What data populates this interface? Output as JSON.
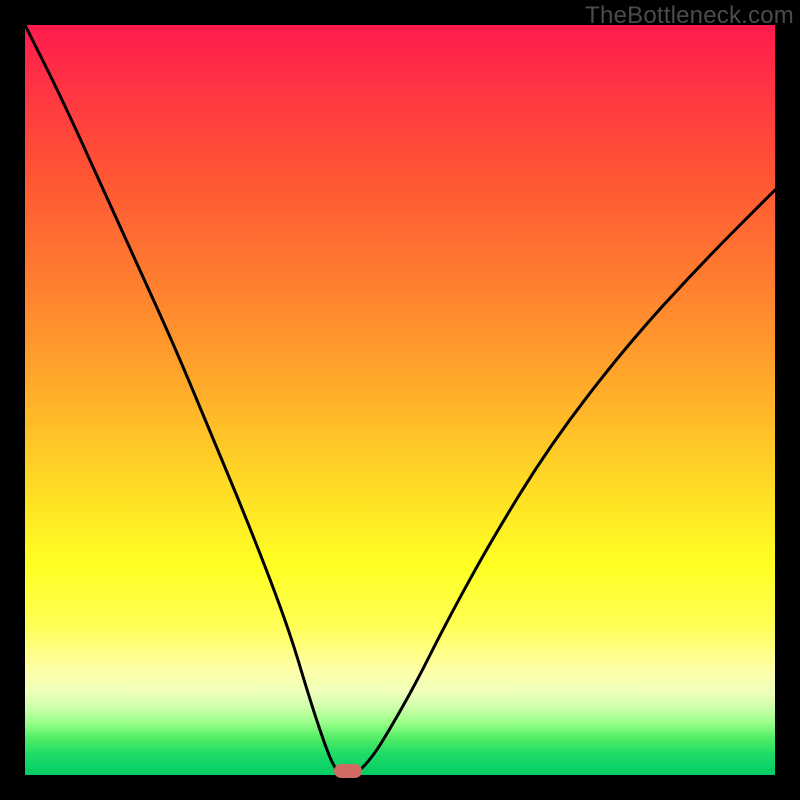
{
  "watermark": "TheBottleneck.com",
  "chart_data": {
    "type": "line",
    "title": "",
    "xlabel": "",
    "ylabel": "",
    "xlim": [
      0,
      100
    ],
    "ylim": [
      0,
      100
    ],
    "grid": false,
    "legend": false,
    "series": [
      {
        "name": "left-curve",
        "x": [
          0,
          5,
          10,
          15,
          20,
          25,
          30,
          35,
          38,
          40,
          41,
          42
        ],
        "y": [
          100,
          90,
          79,
          68,
          57,
          45,
          33,
          20,
          10,
          4,
          1.5,
          0
        ]
      },
      {
        "name": "right-curve",
        "x": [
          44,
          46,
          48,
          52,
          56,
          62,
          70,
          80,
          90,
          100
        ],
        "y": [
          0,
          2,
          5,
          12,
          20,
          31,
          44,
          57,
          68,
          78
        ]
      }
    ],
    "marker": {
      "x": 43,
      "y": 0,
      "color": "#cf6a63",
      "shape": "rounded-rect"
    },
    "gradient_stops": [
      {
        "pos": 0,
        "color": "#ff1a4d"
      },
      {
        "pos": 50,
        "color": "#ffaa2a"
      },
      {
        "pos": 72,
        "color": "#ffff22"
      },
      {
        "pos": 100,
        "color": "#00cc66"
      }
    ]
  }
}
